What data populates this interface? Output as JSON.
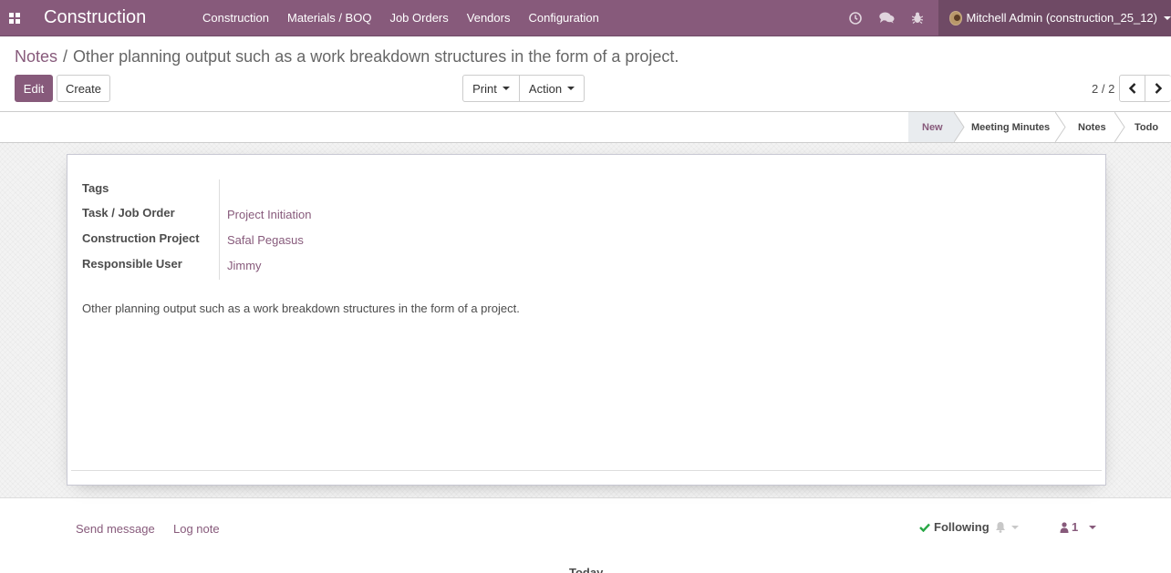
{
  "navbar": {
    "app_title": "Construction",
    "menu": [
      "Construction",
      "Materials / BOQ",
      "Job Orders",
      "Vendors",
      "Configuration"
    ],
    "user": "Mitchell Admin (construction_25_12)"
  },
  "breadcrumb": {
    "parent": "Notes",
    "separator": "/",
    "current": "Other planning output such as a work breakdown structures in the form of a project."
  },
  "buttons": {
    "edit": "Edit",
    "create": "Create",
    "print": "Print",
    "action": "Action"
  },
  "pager": {
    "value": "2 / 2"
  },
  "stages": {
    "items": [
      "New",
      "Meeting Minutes",
      "Notes",
      "Todo"
    ],
    "active": "New"
  },
  "form": {
    "tags_label": "Tags",
    "task_label": "Task / Job Order",
    "task_value": "Project Initiation",
    "project_label": "Construction Project",
    "project_value": "Safal Pegasus",
    "user_label": "Responsible User",
    "user_value": "Jimmy",
    "note": "Other planning output such as a work breakdown structures in the form of a project."
  },
  "chatter": {
    "send_message": "Send message",
    "log_note": "Log note",
    "following": "Following",
    "followers_count": "1",
    "today": "Today"
  },
  "colors": {
    "brand": "#875a7b",
    "brand_dark": "#6f4a65",
    "success": "#28a745"
  }
}
